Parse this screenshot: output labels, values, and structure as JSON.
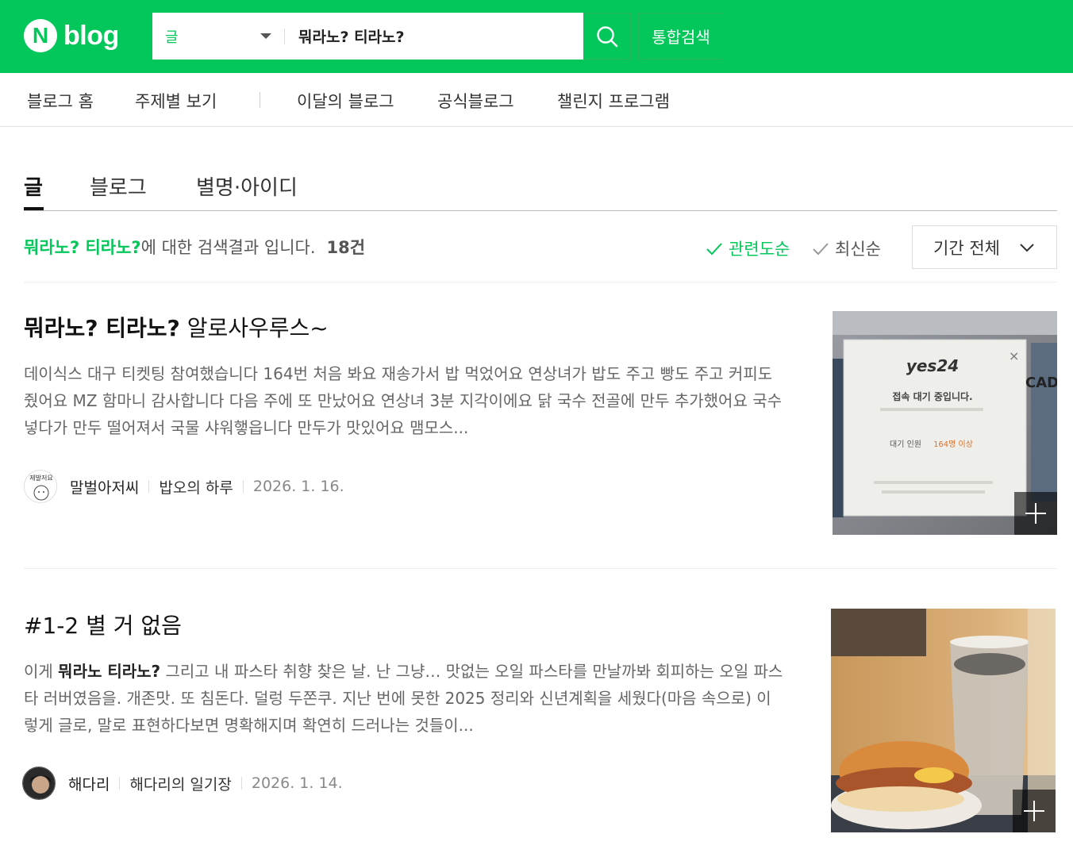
{
  "brand": {
    "logo_letter": "N",
    "logo_text": "blog",
    "accent": "#03c75a"
  },
  "search": {
    "type_label": "글",
    "query": "뭐라노? 티라노?",
    "total_label": "통합검색"
  },
  "nav": [
    "블로그 홈",
    "주제별 보기",
    "이달의 블로그",
    "공식블로그",
    "챌린지 프로그램"
  ],
  "tabs": [
    "글",
    "블로그",
    "별명·아이디"
  ],
  "results": {
    "keyword": "뭐라노? 티라노?",
    "suffix": "에 대한 검색결과 입니다.",
    "count": "18건",
    "sort_relevance": "관련도순",
    "sort_latest": "최신순",
    "period": "기간 전체"
  },
  "posts": [
    {
      "title_bold": "뭐라노? 티라노?",
      "title_rest": " 알로사우루스~",
      "body": "데이식스 대구 티켓팅 참여했습니다 164번 처음 봐요 재송가서 밥 먹었어요 연상녀가 밥도 주고 빵도 주고 커피도 줬어요 MZ 함마니 감사합니다 다음 주에 또 만났어요 연상녀 3분 지각이에요 닭 국수 전골에 만두 추가했어요 국수 넣다가 만두 떨어져서 국물 샤워햏읍니다 만두가 맛있어요 맴모스...",
      "author": "말벌아저씨",
      "blog": "밥오의 하루",
      "date": "2026. 1. 16.",
      "avatar_text": "제발저요",
      "thumb": {
        "brand": "yes24",
        "line1": "접속 대기 중입니다.",
        "line2_label": "대기 인원",
        "line2_value": "164명 이상",
        "side": "CAD"
      }
    },
    {
      "title": "#1-2 별 거 없음",
      "body_pre": "이게 ",
      "body_bold": "뭐라노 티라노?",
      "body_post": " 그리고 내 파스타 취향 찾은 날. 난 그냥… 맛없는 오일 파스타를 만날까봐 회피하는 오일 파스타 러버였음을. 개존맛. 또 침돈다. 덜렁 두쫀쿠. 지난 번에 못한 2025 정리와 신년계획을 세웠다(마음 속으로) 이렇게 글로, 말로 표현하다보면 명확해지며 확연히 드러나는 것들이...",
      "author": "해다리",
      "blog": "해다리의 일기장",
      "date": "2026. 1. 14."
    }
  ]
}
